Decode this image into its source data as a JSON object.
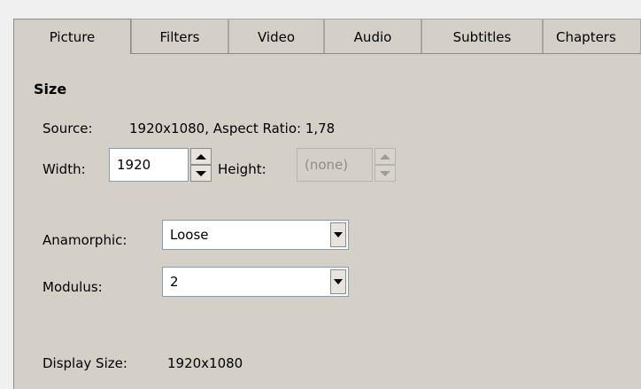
{
  "tabs": [
    {
      "label": "Picture",
      "active": true
    },
    {
      "label": "Filters",
      "active": false
    },
    {
      "label": "Video",
      "active": false
    },
    {
      "label": "Audio",
      "active": false
    },
    {
      "label": "Subtitles",
      "active": false
    },
    {
      "label": "Chapters",
      "active": false
    }
  ],
  "size_section": {
    "title": "Size",
    "source_label": "Source:",
    "source_value": "1920x1080, Aspect Ratio: 1,78",
    "width_label": "Width:",
    "width_value": "1920",
    "height_label": "Height:",
    "height_value": "(none)",
    "anamorphic_label": "Anamorphic:",
    "anamorphic_value": "Loose",
    "modulus_label": "Modulus:",
    "modulus_value": "2",
    "display_size_label": "Display Size:",
    "display_size_value": "1920x1080"
  },
  "icons": {
    "spin_up": "arrow-up-icon",
    "spin_down": "arrow-down-icon",
    "dropdown": "chevron-down-icon"
  }
}
